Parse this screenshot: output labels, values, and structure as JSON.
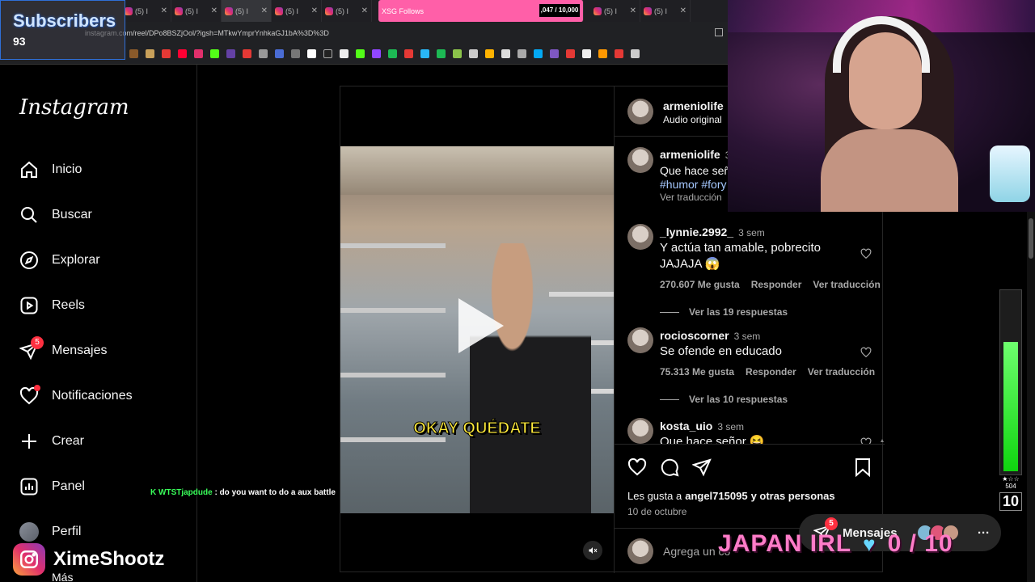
{
  "overlay": {
    "subscribers_label": "Subscribers",
    "subscribers_count": "93",
    "brand_name": "XimeShootz",
    "chat_user": "WTSTjapdude",
    "chat_message": ": do you want to do a aux battle",
    "follow_goal_label": "XSG Follows",
    "follow_goal_value": ",047 / 10,000",
    "japan_text": "JAPAN IRL",
    "japan_counter": "0 / 10",
    "meter_small": "504",
    "meter_big": "10"
  },
  "browser": {
    "url": "instagram.com/reel/DPo8BSZjOol/?igsh=MTkwYmprYnhkaGJ1bA%3D%3D",
    "tabs": [
      {
        "label": "(5) I"
      },
      {
        "label": "(5) I"
      },
      {
        "label": "(5) I"
      },
      {
        "label": "(5) I"
      },
      {
        "label": "(5) I"
      },
      {
        "label": "(5) I"
      },
      {
        "label": "(5) I"
      },
      {
        "label": "(5) I"
      }
    ]
  },
  "nav": {
    "logo": "Instagram",
    "items": [
      {
        "label": "Inicio",
        "icon": "home-icon"
      },
      {
        "label": "Buscar",
        "icon": "search-icon"
      },
      {
        "label": "Explorar",
        "icon": "compass-icon"
      },
      {
        "label": "Reels",
        "icon": "reels-icon"
      },
      {
        "label": "Mensajes",
        "icon": "messages-icon",
        "badge": "5"
      },
      {
        "label": "Notificaciones",
        "icon": "heart-icon"
      },
      {
        "label": "Crear",
        "icon": "plus-icon"
      },
      {
        "label": "Panel",
        "icon": "dashboard-icon"
      },
      {
        "label": "Perfil",
        "icon": "avatar"
      }
    ],
    "more": "Más"
  },
  "post": {
    "author": "armeniolife",
    "audio": "Audio original",
    "video_caption": "OKAY QUÉDATE",
    "caption": {
      "author": "armeniolife",
      "time": "3",
      "text": "Que hace seño",
      "tags": "#humor #fory",
      "translate": "Ver traducción"
    },
    "comments": [
      {
        "user": "_lynnie.2992_",
        "time": "3 sem",
        "text": "Y actúa tan amable, pobrecito JAJAJA 😱",
        "likes": "270.607 Me gusta",
        "reply": "Responder",
        "translate": "Ver traducción",
        "replies": "Ver las 19 respuestas"
      },
      {
        "user": "rocioscorner",
        "time": "3 sem",
        "text": "Se ofende en educado",
        "likes": "75.313 Me gusta",
        "reply": "Responder",
        "translate": "Ver traducción",
        "replies": "Ver las 10 respuestas"
      },
      {
        "user": "kosta_uio",
        "time": "3 sem",
        "text": "Que hace señor 😆"
      }
    ],
    "liked_by": "Les gusta a",
    "liked_user": "angel715095",
    "liked_rest": "y otras personas",
    "date": "10 de octubre",
    "comment_placeholder": "Agrega un co"
  },
  "messages_bar": {
    "label": "Mensajes",
    "badge": "5"
  },
  "colors": {
    "accent_red": "#ff3040",
    "link_blue": "#e0f1ff",
    "follow_pink": "#ff5fa8"
  }
}
